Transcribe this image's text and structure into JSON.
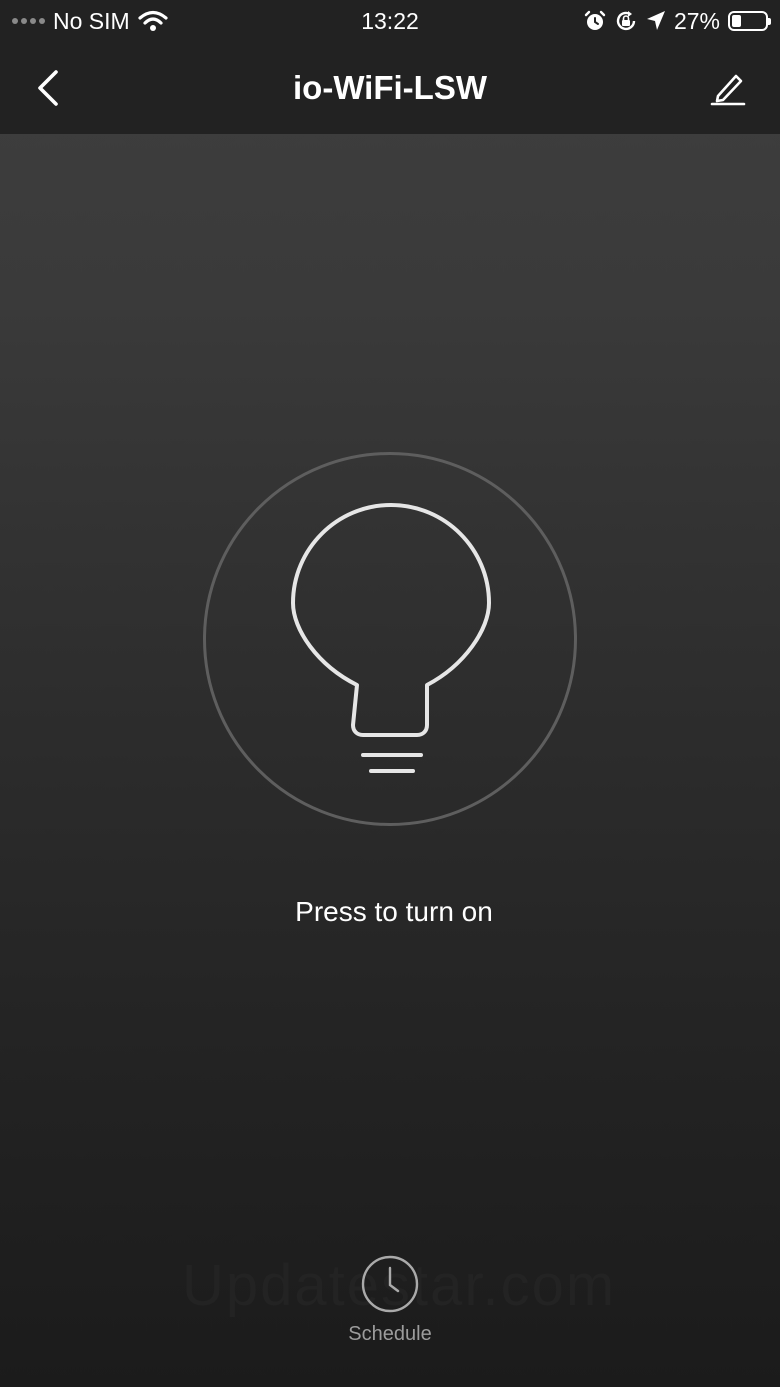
{
  "status_bar": {
    "carrier": "No SIM",
    "time": "13:22",
    "battery_percent": "27%",
    "battery_level": 0.27,
    "icons": [
      "signal-dots-icon",
      "wifi-icon",
      "alarm-icon",
      "rotation-lock-icon",
      "location-arrow-icon",
      "battery-icon"
    ]
  },
  "header": {
    "title": "io-WiFi-LSW",
    "back_icon": "chevron-left-icon",
    "edit_icon": "pencil-icon"
  },
  "main": {
    "power_icon": "light-bulb-icon",
    "prompt": "Press to turn on"
  },
  "footer": {
    "schedule_label": "Schedule",
    "schedule_icon": "clock-icon",
    "watermark": "Updatestar.com"
  },
  "colors": {
    "background_top": "#3f3f3f",
    "background_bottom": "#1b1b1b",
    "header_bg": "#222222",
    "ring": "#5e5e5e",
    "bulb_stroke": "#e6e6e6",
    "secondary_text": "#9c9c9c"
  }
}
